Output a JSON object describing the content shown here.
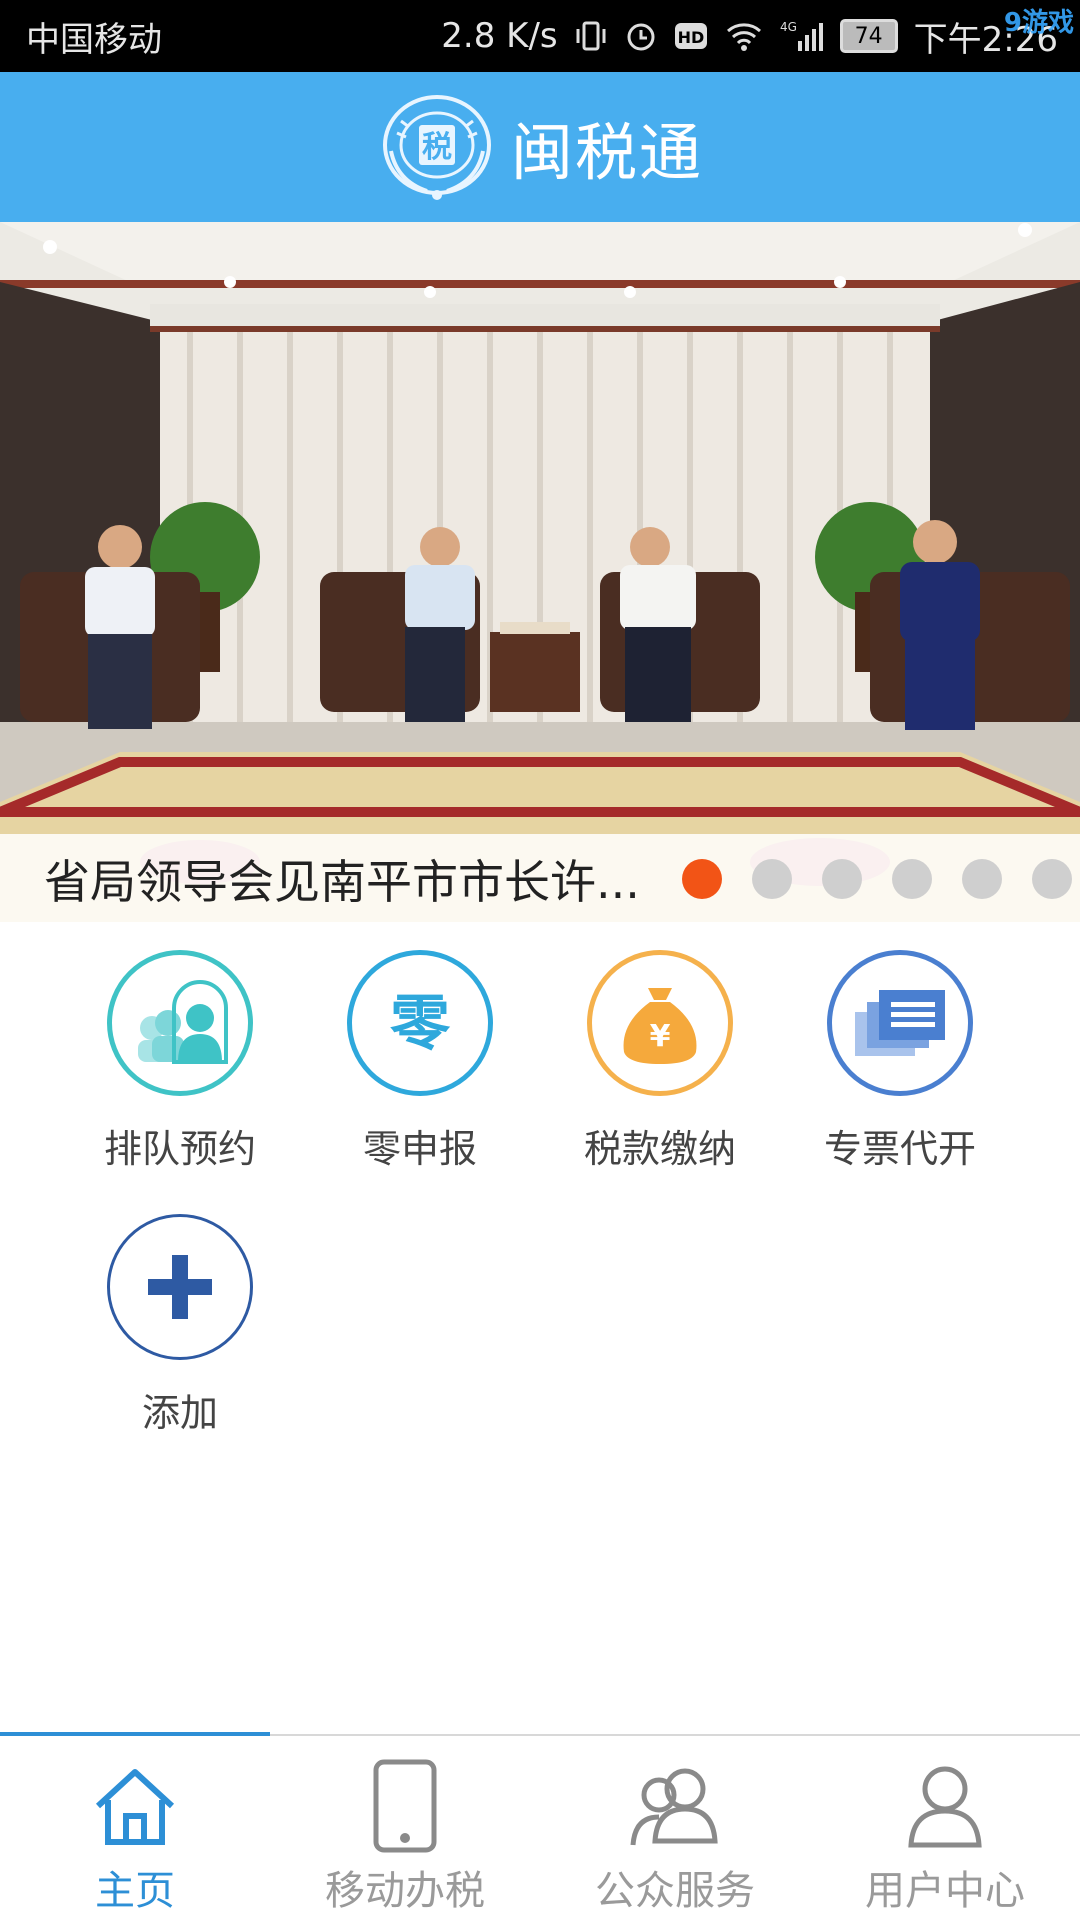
{
  "status_bar": {
    "carrier": "中国移动",
    "speed": "2.8 K/s",
    "network": "4G",
    "battery": "74",
    "time": "下午2:26",
    "watermark": "游戏"
  },
  "header": {
    "title": "闽税通",
    "emblem_text": "税",
    "bg_color": "#48aeef"
  },
  "banner": {
    "caption": "省局领导会见南平市市长许...",
    "slide_count": 6,
    "active_slide": 1
  },
  "services": [
    {
      "label": "排队预约",
      "icon": "queue-reservation-icon",
      "color": "#3fc3c6"
    },
    {
      "label": "零申报",
      "icon": "zero-declaration-icon",
      "color": "#2ea8dc",
      "glyph": "零"
    },
    {
      "label": "税款缴纳",
      "icon": "tax-payment-bag-icon",
      "color": "#f5b14c",
      "glyph": "¥"
    },
    {
      "label": "专票代开",
      "icon": "invoice-icon",
      "color": "#4a7fd0"
    },
    {
      "label": "添加",
      "icon": "plus-icon",
      "color": "#2e5aa3"
    }
  ],
  "bottom_nav": [
    {
      "label": "主页",
      "icon": "home-icon",
      "active": true
    },
    {
      "label": "移动办税",
      "icon": "phone-icon",
      "active": false
    },
    {
      "label": "公众服务",
      "icon": "users-icon",
      "active": false
    },
    {
      "label": "用户中心",
      "icon": "user-icon",
      "active": false
    }
  ]
}
